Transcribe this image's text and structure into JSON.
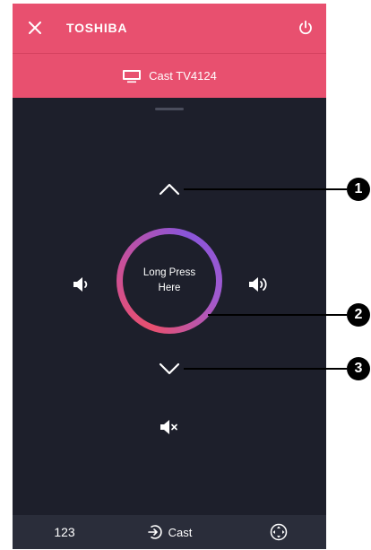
{
  "header": {
    "brand": "TOSHIBA",
    "close_icon": "close-icon",
    "power_icon": "power-icon"
  },
  "cast_bar": {
    "label": "Cast TV4124",
    "icon": "tv-icon"
  },
  "remote": {
    "center_label": "Long Press Here",
    "up_icon": "chevron-up-icon",
    "down_icon": "chevron-down-icon",
    "vol_down_icon": "volume-down-icon",
    "vol_up_icon": "volume-up-icon",
    "mute_icon": "mute-icon"
  },
  "bottom_bar": {
    "numpad_label": "123",
    "cast_label": "Cast",
    "cast_icon": "cast-input-icon",
    "dpad_icon": "dpad-icon"
  },
  "callouts": [
    "1",
    "2",
    "3"
  ],
  "colors": {
    "accent": "#e8506f",
    "background": "#1d1f2b",
    "bottom_bar": "#2a2d3a",
    "ring_gradient_end": "#8a55d9"
  }
}
